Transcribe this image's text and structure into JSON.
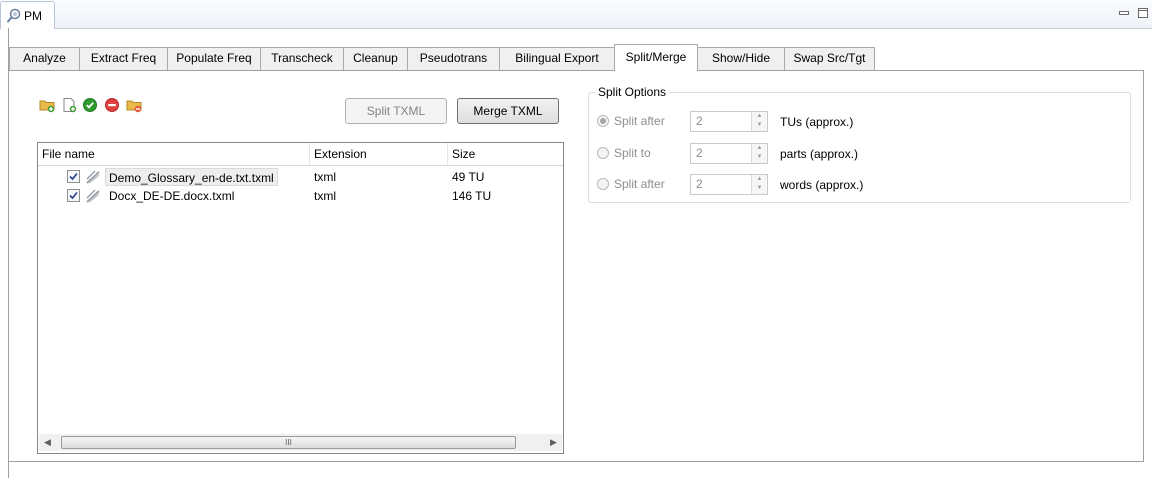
{
  "view": {
    "title": "PM",
    "icon": "pm-view-icon"
  },
  "tabs": [
    {
      "label": "Analyze",
      "active": false
    },
    {
      "label": "Extract Freq",
      "active": false
    },
    {
      "label": "Populate Freq",
      "active": false
    },
    {
      "label": "Transcheck",
      "active": false
    },
    {
      "label": "Cleanup",
      "active": false
    },
    {
      "label": "Pseudotrans",
      "active": false
    },
    {
      "label": "Bilingual Export",
      "active": false
    },
    {
      "label": "Split/Merge",
      "active": true
    },
    {
      "label": "Show/Hide",
      "active": false
    },
    {
      "label": "Swap Src/Tgt",
      "active": false
    }
  ],
  "toolbar": {
    "icons": [
      "add-folder-icon",
      "add-file-icon",
      "check-icon",
      "remove-icon",
      "open-folder-icon"
    ],
    "split_button": "Split TXML",
    "merge_button": "Merge TXML"
  },
  "file_table": {
    "columns": [
      "File name",
      "Extension",
      "Size"
    ],
    "rows": [
      {
        "checked": true,
        "name": "Demo_Glossary_en-de.txt.txml",
        "extension": "txml",
        "size": "49 TU"
      },
      {
        "checked": true,
        "name": "Docx_DE-DE.docx.txml",
        "extension": "txml",
        "size": "146 TU"
      }
    ],
    "scroll_thumb_label": "III"
  },
  "split_options": {
    "legend": "Split Options",
    "options": [
      {
        "label": "Split after",
        "value": "2",
        "unit": "TUs (approx.)",
        "selected": true
      },
      {
        "label": "Split to",
        "value": "2",
        "unit": "parts (approx.)",
        "selected": false
      },
      {
        "label": "Split after",
        "value": "2",
        "unit": "words (approx.)",
        "selected": false
      }
    ]
  },
  "colors": {
    "accent": "#3c7fb1",
    "check_green": "#2f9b2f",
    "remove_red": "#e04040",
    "folder_yellow": "#e8b84a"
  }
}
